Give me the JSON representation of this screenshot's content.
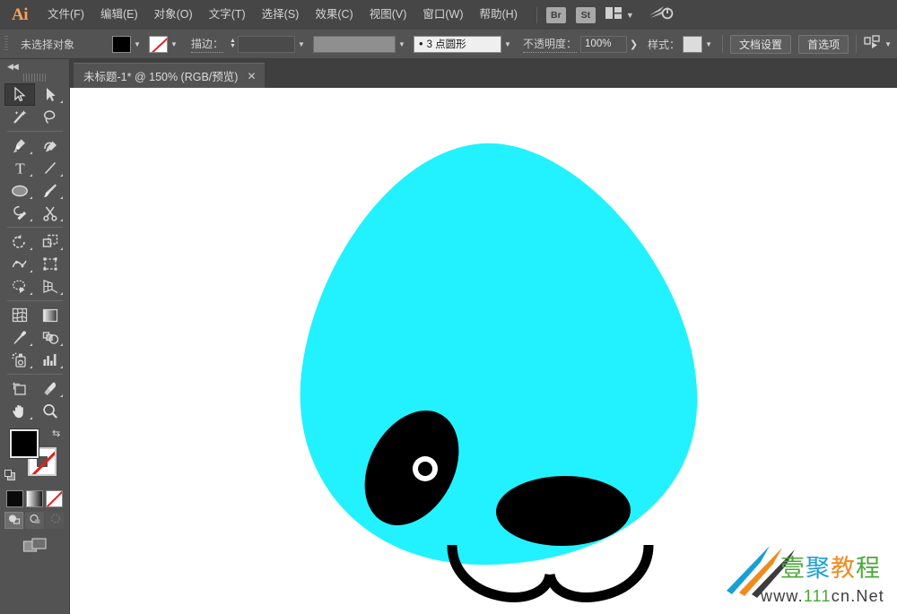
{
  "app": {
    "name": "Ai",
    "logo_text": "Ai"
  },
  "menubar": {
    "items": [
      {
        "label": "文件(F)",
        "name": "menu-file"
      },
      {
        "label": "编辑(E)",
        "name": "menu-edit"
      },
      {
        "label": "对象(O)",
        "name": "menu-object"
      },
      {
        "label": "文字(T)",
        "name": "menu-type"
      },
      {
        "label": "选择(S)",
        "name": "menu-select"
      },
      {
        "label": "效果(C)",
        "name": "menu-effect"
      },
      {
        "label": "视图(V)",
        "name": "menu-view"
      },
      {
        "label": "窗口(W)",
        "name": "menu-window"
      },
      {
        "label": "帮助(H)",
        "name": "menu-help"
      }
    ],
    "bridge_label": "Br",
    "stock_label": "St",
    "arrange_icon": "arrange-documents-icon",
    "workspace_icon": "workspace-switcher-icon"
  },
  "controlbar": {
    "selection_status": "未选择对象",
    "fill_swatch_color": "#000000",
    "stroke_swatch": "none",
    "stroke_label": "描边：",
    "stroke_weight_value": "",
    "brush_value": "",
    "profile_value": "3 点圆形",
    "opacity_label": "不透明度：",
    "opacity_value": "100%",
    "style_label": "样式：",
    "style_swatch_color": "#dcdcdc",
    "document_setup_label": "文档设置",
    "preferences_label": "首选项",
    "align_icon": "align-to-artboard-icon"
  },
  "tabbar": {
    "tab_title": "未标题-1* @ 150% (RGB/预览)",
    "close_label": "✕"
  },
  "toolpanel": {
    "collapse_icon": "collapse-panel-icon",
    "collapse_glyph": "◀◀",
    "tools": [
      {
        "name": "selection-tool",
        "icon": "arrow-cursor-icon",
        "selected": true,
        "has_flyout": false
      },
      {
        "name": "direct-selection-tool",
        "icon": "direct-select-arrow-icon",
        "selected": false,
        "has_flyout": true
      },
      {
        "name": "magic-wand-tool",
        "icon": "magic-wand-icon",
        "selected": false,
        "has_flyout": false
      },
      {
        "name": "lasso-tool",
        "icon": "lasso-icon",
        "selected": false,
        "has_flyout": false
      },
      {
        "name": "pen-tool",
        "icon": "pen-icon",
        "selected": false,
        "has_flyout": true
      },
      {
        "name": "curvature-tool",
        "icon": "curvature-pen-icon",
        "selected": false,
        "has_flyout": false
      },
      {
        "name": "type-tool",
        "icon": "type-T-icon",
        "selected": false,
        "has_flyout": true
      },
      {
        "name": "line-segment-tool",
        "icon": "line-segment-icon",
        "selected": false,
        "has_flyout": true
      },
      {
        "name": "ellipse-tool",
        "icon": "ellipse-icon",
        "selected": false,
        "has_flyout": true
      },
      {
        "name": "paintbrush-tool",
        "icon": "paintbrush-icon",
        "selected": false,
        "has_flyout": true
      },
      {
        "name": "shaper-tool",
        "icon": "shaper-pencil-icon",
        "selected": false,
        "has_flyout": true
      },
      {
        "name": "scissors-tool",
        "icon": "scissors-icon",
        "selected": false,
        "has_flyout": true
      },
      {
        "name": "rotate-tool",
        "icon": "rotate-icon",
        "selected": false,
        "has_flyout": true
      },
      {
        "name": "scale-tool",
        "icon": "scale-icon",
        "selected": false,
        "has_flyout": true
      },
      {
        "name": "width-warp-tool",
        "icon": "warp-icon",
        "selected": false,
        "has_flyout": true
      },
      {
        "name": "free-transform-tool",
        "icon": "free-transform-icon",
        "selected": false,
        "has_flyout": false
      },
      {
        "name": "shape-builder-tool",
        "icon": "shape-builder-icon",
        "selected": false,
        "has_flyout": true
      },
      {
        "name": "perspective-grid-tool",
        "icon": "perspective-grid-icon",
        "selected": false,
        "has_flyout": true
      },
      {
        "name": "mesh-tool",
        "icon": "mesh-icon",
        "selected": false,
        "has_flyout": false
      },
      {
        "name": "gradient-tool",
        "icon": "gradient-icon",
        "selected": false,
        "has_flyout": false
      },
      {
        "name": "eyedropper-tool",
        "icon": "eyedropper-icon",
        "selected": false,
        "has_flyout": true
      },
      {
        "name": "blend-tool",
        "icon": "blend-icon",
        "selected": false,
        "has_flyout": true
      },
      {
        "name": "symbol-sprayer-tool",
        "icon": "symbol-sprayer-icon",
        "selected": false,
        "has_flyout": true
      },
      {
        "name": "column-graph-tool",
        "icon": "column-graph-icon",
        "selected": false,
        "has_flyout": true
      },
      {
        "name": "artboard-tool",
        "icon": "artboard-icon",
        "selected": false,
        "has_flyout": false
      },
      {
        "name": "slice-tool",
        "icon": "slice-knife-icon",
        "selected": false,
        "has_flyout": true
      },
      {
        "name": "hand-tool",
        "icon": "hand-icon",
        "selected": false,
        "has_flyout": true
      },
      {
        "name": "zoom-tool",
        "icon": "magnifier-icon",
        "selected": false,
        "has_flyout": false
      }
    ],
    "fill_color": "#000000",
    "stroke_color": "none",
    "swap_icon": "swap-fill-stroke-icon",
    "default_icon": "default-fill-stroke-icon",
    "color_modes": [
      {
        "name": "color-mode-solid",
        "icon": "solid-color-icon"
      },
      {
        "name": "color-mode-gradient",
        "icon": "gradient-swatch-icon"
      },
      {
        "name": "color-mode-none",
        "icon": "none-swatch-icon"
      }
    ],
    "draw_modes": [
      {
        "name": "draw-normal-mode",
        "icon": "draw-normal-icon",
        "active": true,
        "disabled": false
      },
      {
        "name": "draw-behind-mode",
        "icon": "draw-behind-icon",
        "active": false,
        "disabled": false
      },
      {
        "name": "draw-inside-mode",
        "icon": "draw-inside-icon",
        "active": false,
        "disabled": true
      }
    ],
    "screen_mode": {
      "name": "screen-mode-button",
      "icon": "screen-mode-icon"
    }
  },
  "canvas": {
    "background": "#ffffff",
    "artwork_name": "dog-face-illustration",
    "shapes": {
      "head": {
        "name": "head-shape",
        "fill": "#22f2ff"
      },
      "eye": {
        "name": "eye-shape",
        "fill": "#000000"
      },
      "pupil_ring": {
        "name": "pupil-ring",
        "fill": "#ffffff"
      },
      "nose": {
        "name": "nose-shape",
        "fill": "#000000"
      },
      "mouth": {
        "name": "mouth-shape",
        "stroke": "#000000"
      }
    }
  },
  "watermark": {
    "brand_cn": "壹聚教程",
    "url": "www.111cn.Net",
    "colors": {
      "blue": "#1a9fd4",
      "orange": "#f08a1e",
      "dark": "#3c3c3c",
      "green": "#4aa838"
    }
  }
}
